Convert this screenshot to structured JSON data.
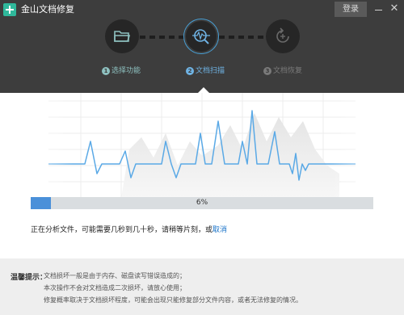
{
  "window": {
    "title": "金山文档修复",
    "login_label": "登录",
    "minimize_icon": "minimize-icon",
    "close_icon": "close-icon"
  },
  "steps": [
    {
      "number": "1",
      "label": "选择功能",
      "icon": "folder-icon",
      "state": "completed"
    },
    {
      "number": "2",
      "label": "文档扫描",
      "icon": "scan-icon",
      "state": "active"
    },
    {
      "number": "3",
      "label": "文档恢复",
      "icon": "restore-icon",
      "state": "pending"
    }
  ],
  "progress": {
    "percent": 6,
    "text": "6%"
  },
  "status": {
    "message": "正在分析文件，可能需要几秒到几十秒，请稍等片刻，或",
    "cancel_label": "取消"
  },
  "tips": {
    "title": "温馨提示：",
    "lines": [
      "文档损坏一般是由于内存、磁盘读写错误造成的；",
      "本次操作不会对文档造成二次损坏，请放心使用；",
      "修复概率取决于文档损坏程度，可能会出现只能修复部分文件内容，或者无法修复的情况。"
    ]
  },
  "colors": {
    "header_bg": "#3d3d3d",
    "accent_green": "#2fb89b",
    "accent_blue": "#4a90d9",
    "active_step": "#6fb3e4",
    "completed_step": "#8ec1c0"
  }
}
